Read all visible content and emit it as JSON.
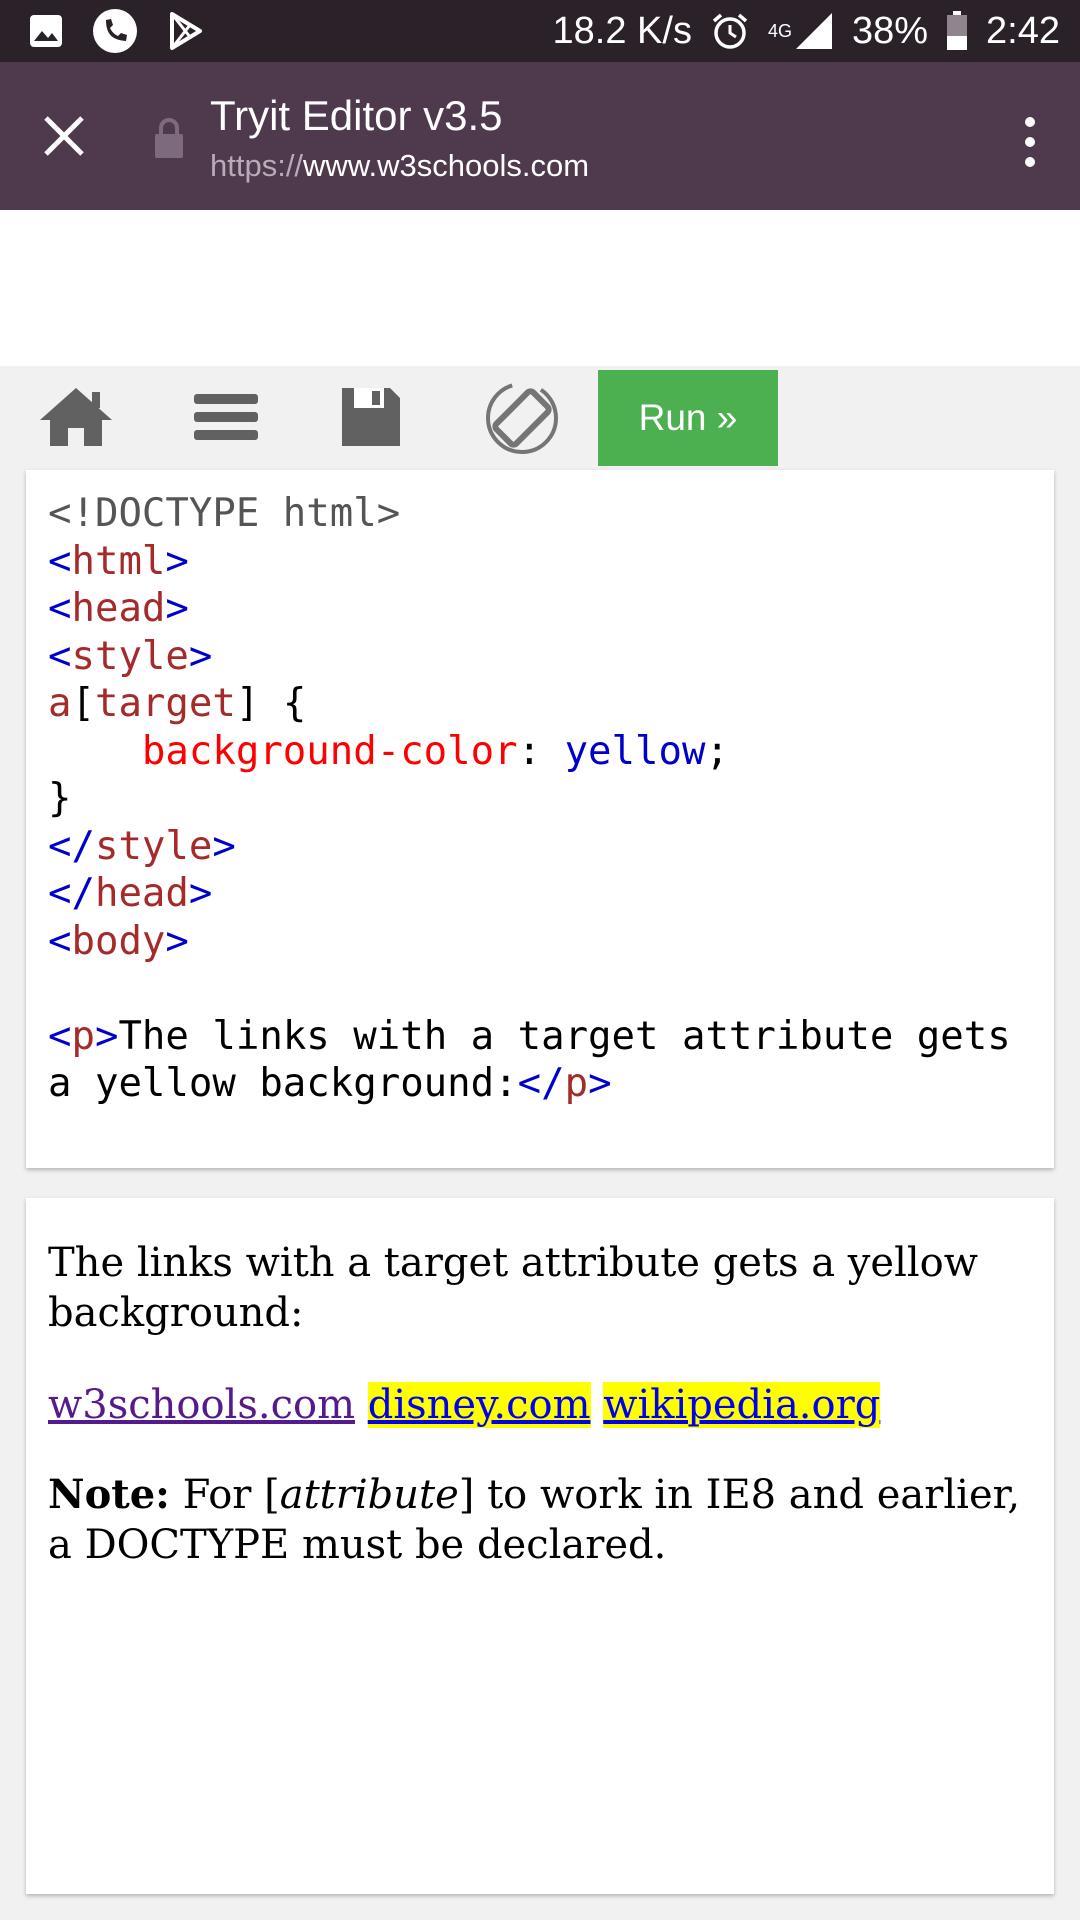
{
  "status_bar": {
    "net_speed": "18.2 K/s",
    "network": "4G",
    "battery": "38%",
    "time": "2:42",
    "icons": [
      "image-icon",
      "phone-icon",
      "play-store-icon",
      "alarm-icon",
      "signal-icon",
      "battery-icon"
    ]
  },
  "browser": {
    "title": "Tryit Editor v3.5",
    "url_scheme": "https://",
    "url_host": "www.w3schools.com"
  },
  "toolbar": {
    "run_label": "Run »",
    "run_color": "#4caf50",
    "icons": [
      "home-icon",
      "menu-icon",
      "save-icon",
      "rotate-icon"
    ]
  },
  "code": {
    "doctype": "<!DOCTYPE html>",
    "html_tag": "html",
    "head_tag": "head",
    "style_tag": "style",
    "selector_el": "a",
    "selector_attr": "target",
    "property": "background-color",
    "value": "yellow",
    "body_tag": "body",
    "p_tag": "p",
    "p_text_1": "The links with a target attribute gets",
    "p_text_2": "a yellow background:"
  },
  "result": {
    "intro": "The links with a target attribute gets a yellow background:",
    "links": [
      "w3schools.com",
      "disney.com",
      "wikipedia.org"
    ],
    "note_label": "Note:",
    "note_text_a": " For [",
    "note_em": "attribute",
    "note_text_b": "] to work in IE8 and earlier, a DOCTYPE must be declared."
  }
}
